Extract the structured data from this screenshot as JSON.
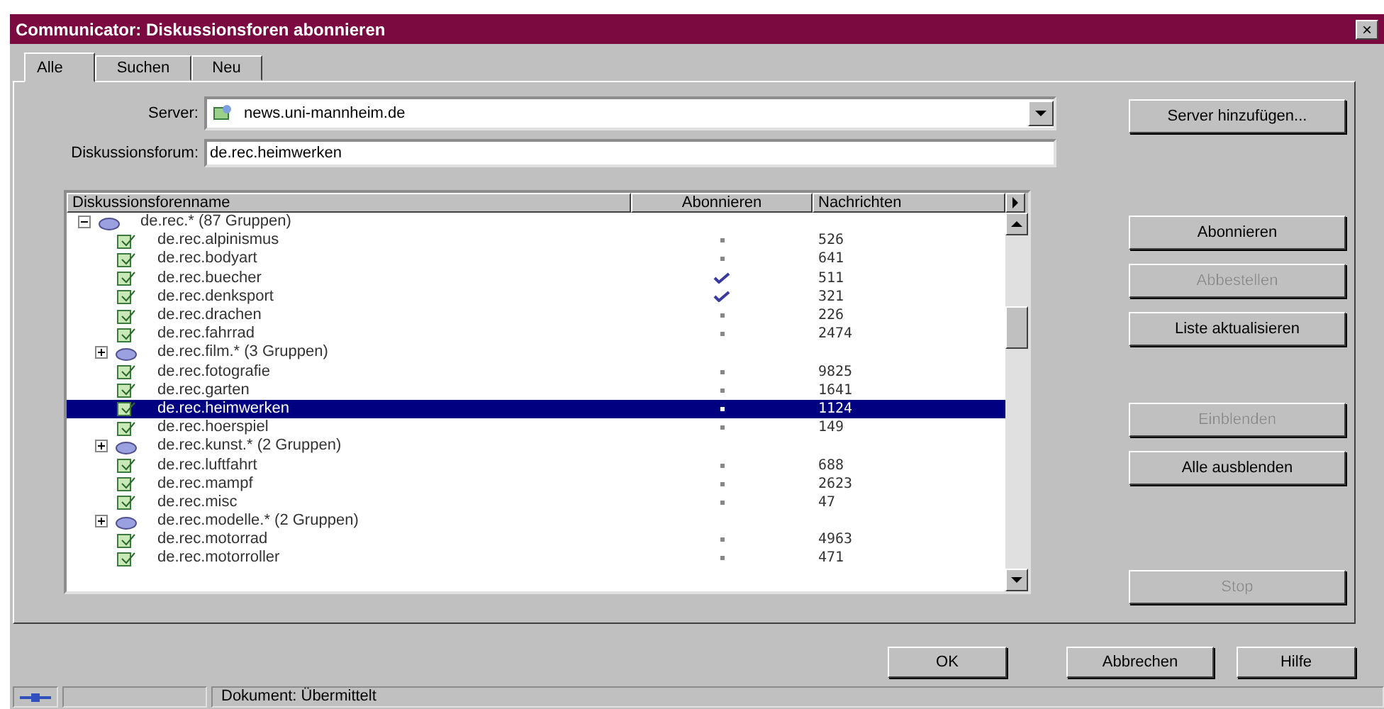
{
  "window": {
    "title": "Communicator: Diskussionsforen abonnieren",
    "close": "×"
  },
  "tabs": [
    {
      "label": "Alle",
      "selected": true
    },
    {
      "label": "Suchen",
      "selected": false
    },
    {
      "label": "Neu",
      "selected": false
    }
  ],
  "server": {
    "label": "Server:",
    "value": "news.uni-mannheim.de"
  },
  "forum_field": {
    "label": "Diskussionsforum:",
    "value": "de.rec.heimwerken"
  },
  "list": {
    "columns": [
      "Diskussionsforenname",
      "Abonnieren",
      "Nachrichten"
    ],
    "tree": [
      {
        "kind": "group",
        "label": "de.rec.* (87 Gruppen)",
        "expanded": true,
        "selected": false,
        "children": [
          {
            "kind": "forum",
            "label": "de.rec.alpinismus",
            "subscribed": false,
            "count": "526",
            "selected": false
          },
          {
            "kind": "forum",
            "label": "de.rec.bodyart",
            "subscribed": false,
            "count": "641",
            "selected": false
          },
          {
            "kind": "forum",
            "label": "de.rec.buecher",
            "subscribed": true,
            "count": "511",
            "selected": false
          },
          {
            "kind": "forum",
            "label": "de.rec.denksport",
            "subscribed": true,
            "count": "321",
            "selected": false
          },
          {
            "kind": "forum",
            "label": "de.rec.drachen",
            "subscribed": false,
            "count": "226",
            "selected": false
          },
          {
            "kind": "forum",
            "label": "de.rec.fahrrad",
            "subscribed": false,
            "count": "2474",
            "selected": false
          },
          {
            "kind": "group",
            "label": "de.rec.film.* (3 Gruppen)",
            "expanded": false,
            "selected": false
          },
          {
            "kind": "forum",
            "label": "de.rec.fotografie",
            "subscribed": false,
            "count": "9825",
            "selected": false
          },
          {
            "kind": "forum",
            "label": "de.rec.garten",
            "subscribed": false,
            "count": "1641",
            "selected": false
          },
          {
            "kind": "forum",
            "label": "de.rec.heimwerken",
            "subscribed": false,
            "count": "1124",
            "selected": true
          },
          {
            "kind": "forum",
            "label": "de.rec.hoerspiel",
            "subscribed": false,
            "count": "149",
            "selected": false
          },
          {
            "kind": "group",
            "label": "de.rec.kunst.* (2 Gruppen)",
            "expanded": false,
            "selected": false
          },
          {
            "kind": "forum",
            "label": "de.rec.luftfahrt",
            "subscribed": false,
            "count": "688",
            "selected": false
          },
          {
            "kind": "forum",
            "label": "de.rec.mampf",
            "subscribed": false,
            "count": "2623",
            "selected": false
          },
          {
            "kind": "forum",
            "label": "de.rec.misc",
            "subscribed": false,
            "count": "47",
            "selected": false
          },
          {
            "kind": "group",
            "label": "de.rec.modelle.* (2 Gruppen)",
            "expanded": false,
            "selected": false
          },
          {
            "kind": "forum",
            "label": "de.rec.motorrad",
            "subscribed": false,
            "count": "4963",
            "selected": false
          },
          {
            "kind": "forum",
            "label": "de.rec.motorroller",
            "subscribed": false,
            "count": "471",
            "selected": false
          }
        ]
      }
    ]
  },
  "side_buttons": [
    {
      "label": "Server hinzufügen...",
      "disabled": false
    },
    {
      "label": "Abonnieren",
      "disabled": false
    },
    {
      "label": "Abbestellen",
      "disabled": true
    },
    {
      "label": "Liste aktualisieren",
      "disabled": false
    },
    {
      "label": "Einblenden",
      "disabled": true
    },
    {
      "label": "Alle ausblenden",
      "disabled": false
    },
    {
      "label": "Stop",
      "disabled": true
    }
  ],
  "dialog_buttons": [
    "OK",
    "Abbrechen",
    "Hilfe"
  ],
  "status_bar": {
    "text": "Dokument: Übermittelt"
  }
}
